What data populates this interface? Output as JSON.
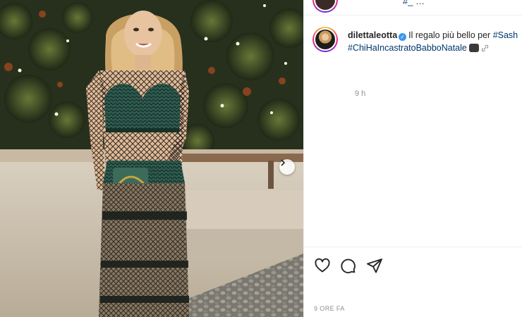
{
  "post": {
    "username": "dilettaleotta",
    "caption_text": "Il regalo più bello per ",
    "hashtag_1": "#Sash",
    "hashtag_2": "#ChiHaIncastratoBabboNatale",
    "time_ago": "9 h",
    "date_label": "9 ORE FA"
  },
  "header": {
    "partial_link": "#_ …"
  },
  "icons": {
    "verified": "verified-badge-icon",
    "like": "heart-icon",
    "comment": "comment-bubble-icon",
    "share": "paper-plane-icon",
    "next": "chevron-right-icon",
    "emoji": "clapper-board-emoji",
    "link": "link-icon"
  },
  "colors": {
    "hashtag": "#00376b",
    "muted": "#8e8e8e",
    "verified": "#3897f0"
  }
}
